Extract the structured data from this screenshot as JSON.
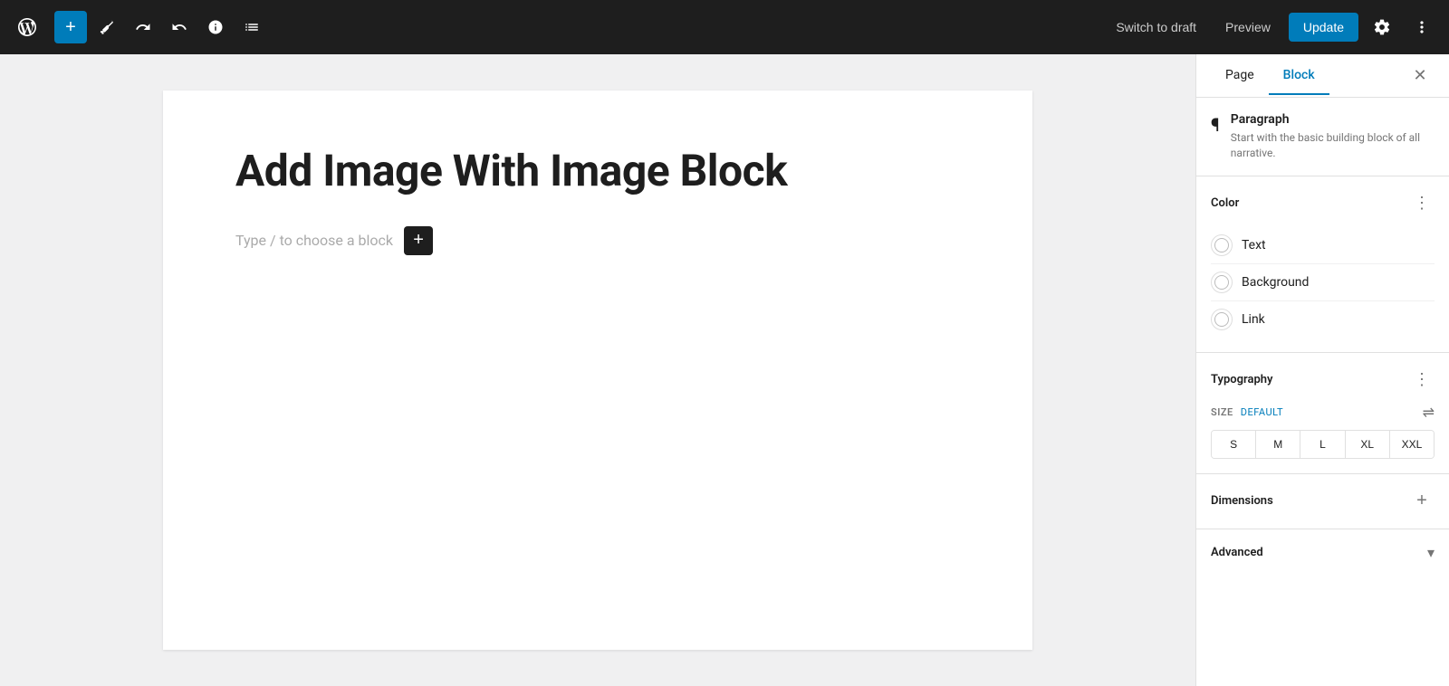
{
  "toolbar": {
    "add_label": "+",
    "pencil_label": "✏",
    "undo_label": "↩",
    "redo_label": "↪",
    "info_label": "ℹ",
    "list_label": "≡",
    "switch_draft_label": "Switch to draft",
    "preview_label": "Preview",
    "update_label": "Update",
    "settings_label": "⚙",
    "more_label": "⋮"
  },
  "editor": {
    "post_title": "Add Image With Image Block",
    "placeholder_text": "Type / to choose a block",
    "add_block_label": "+"
  },
  "panel": {
    "tab_page": "Page",
    "tab_block": "Block",
    "close_label": "✕",
    "block_icon": "¶",
    "block_name": "Paragraph",
    "block_description": "Start with the basic building block of all narrative.",
    "color_section_title": "Color",
    "color_more_label": "⋮",
    "color_items": [
      {
        "label": "Text"
      },
      {
        "label": "Background"
      },
      {
        "label": "Link"
      }
    ],
    "typography_section_title": "Typography",
    "typography_more_label": "⋮",
    "size_label": "SIZE",
    "size_default": "DEFAULT",
    "size_controls_icon": "⇌",
    "size_buttons": [
      "S",
      "M",
      "L",
      "XL",
      "XXL"
    ],
    "dimensions_section_title": "Dimensions",
    "dimensions_add_label": "+",
    "advanced_section_title": "Advanced",
    "advanced_chevron": "▾"
  }
}
